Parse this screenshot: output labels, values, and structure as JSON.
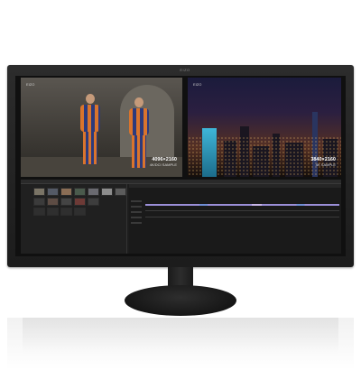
{
  "monitor": {
    "brand_logo": "EIZO"
  },
  "preview_left": {
    "logo": "EIZO",
    "resolution": "4096×2160",
    "subtitle": "4K/DCI SAMPLE"
  },
  "preview_right": {
    "logo": "EIZO",
    "resolution": "3840×2160",
    "subtitle": "4K SAMPLE"
  },
  "colors": {
    "bezel": "#222222",
    "screen": "#101010",
    "timeline_track_purple": "#9b8fd8",
    "timeline_track_blue": "#6f8fd6",
    "guard_orange": "#d9742d",
    "guard_blue": "#2c3a7c"
  }
}
